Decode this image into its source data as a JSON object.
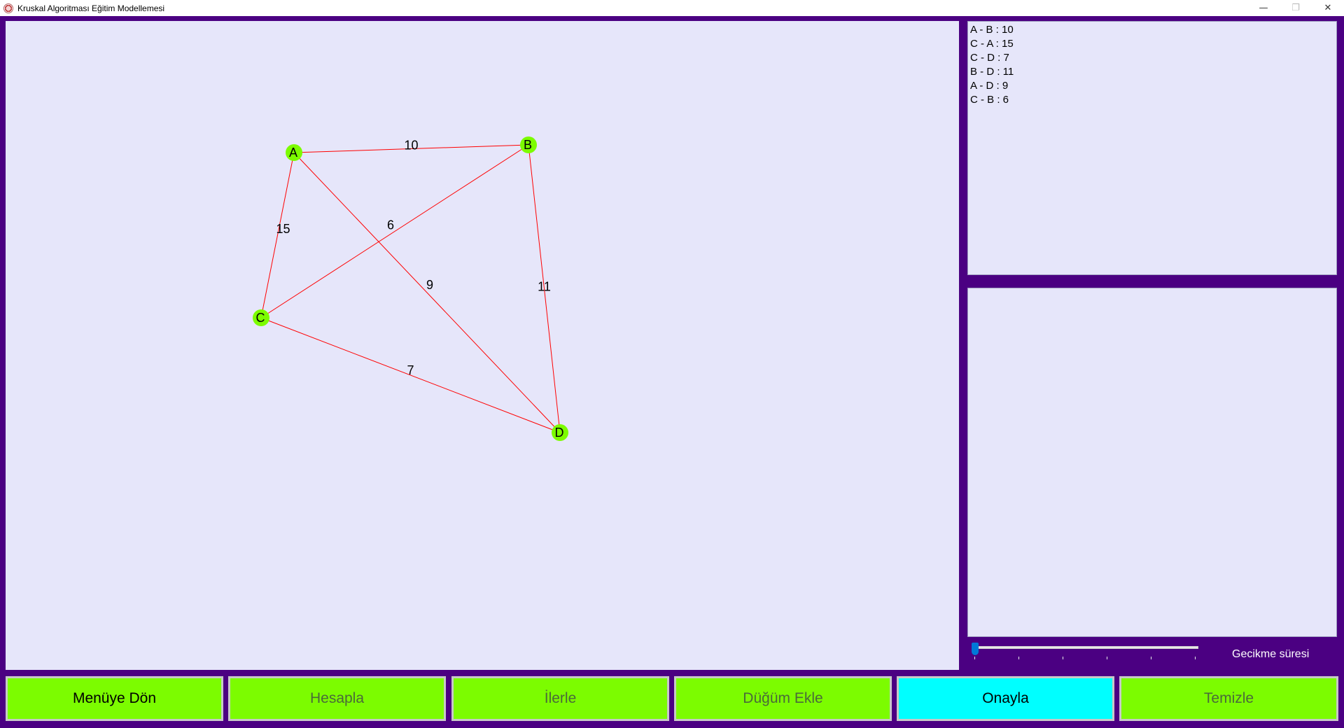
{
  "window": {
    "title": "Kruskal Algoritması Eğitim Modellemesi",
    "minimize_glyph": "—",
    "restore_glyph": "❐",
    "close_glyph": "✕"
  },
  "colors": {
    "background": "#4b0082",
    "panel": "#e6e6fa",
    "node": "#7cfc00",
    "edge": "#ff0000",
    "button": "#7cfc00",
    "button_active": "#00ffff"
  },
  "graph": {
    "nodes": [
      {
        "id": "A",
        "label": "A"
      },
      {
        "id": "B",
        "label": "B"
      },
      {
        "id": "C",
        "label": "C"
      },
      {
        "id": "D",
        "label": "D"
      }
    ],
    "edges": [
      {
        "from": "A",
        "to": "B",
        "weight": "10"
      },
      {
        "from": "C",
        "to": "A",
        "weight": "15"
      },
      {
        "from": "C",
        "to": "D",
        "weight": "7"
      },
      {
        "from": "B",
        "to": "D",
        "weight": "11"
      },
      {
        "from": "A",
        "to": "D",
        "weight": "9"
      },
      {
        "from": "C",
        "to": "B",
        "weight": "6"
      }
    ]
  },
  "edge_list": [
    "A - B : 10",
    "C - A : 15",
    "C - D : 7",
    "B - D : 11",
    "A - D : 9",
    "C - B : 6"
  ],
  "delay": {
    "label": "Gecikme süresi",
    "value": 0,
    "min": 0,
    "max": 5
  },
  "buttons": {
    "menu": "Menüye Dön",
    "calculate": "Hesapla",
    "next": "İlerle",
    "add_node": "Düğüm Ekle",
    "confirm": "Onayla",
    "clear": "Temizle"
  }
}
